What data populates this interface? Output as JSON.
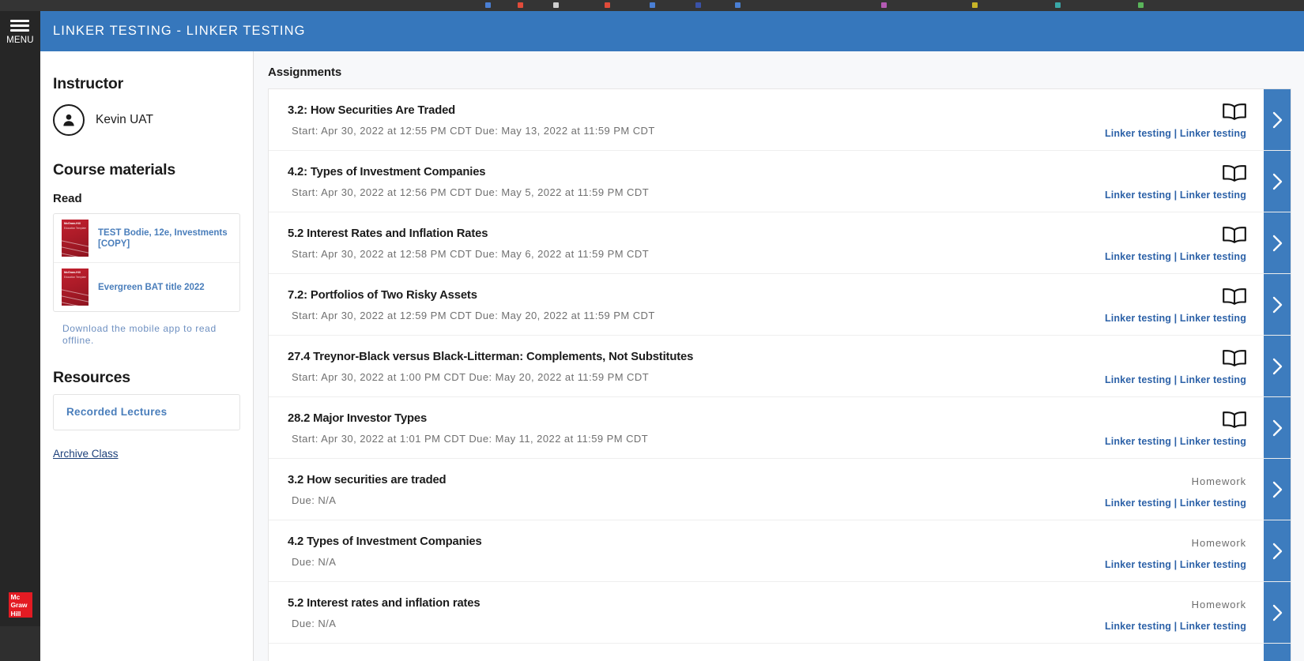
{
  "browser": {
    "strip_color": "#343434"
  },
  "rail": {
    "menu_label": "MENU",
    "menu_icon": "hamburger-icon",
    "logo_line1": "Mc",
    "logo_line2": "Graw",
    "logo_line3": "Hill",
    "logo_color": "#E31B23"
  },
  "header": {
    "title": "LINKER TESTING - LINKER TESTING",
    "background": "#3677BC"
  },
  "sidebar": {
    "instructor_heading": "Instructor",
    "instructor_name": "Kevin UAT",
    "avatar_icon": "user-avatar-icon",
    "course_materials_heading": "Course materials",
    "read_heading": "Read",
    "books": [
      {
        "title": "TEST Bodie, 12e, Investments [COPY]",
        "cover_brand": "McGraw-Hill",
        "cover_sub": "Education Template"
      },
      {
        "title": "Evergreen BAT title 2022",
        "cover_brand": "McGraw-Hill",
        "cover_sub": "Education Template"
      }
    ],
    "mobile_note": "Download the mobile app to read offline.",
    "resources_heading": "Resources",
    "resource_items": [
      "Recorded Lectures"
    ],
    "archive_link": "Archive Class",
    "link_color": "#4A7EBB"
  },
  "main": {
    "title": "Assignments",
    "chevron_icon": "chevron-right-icon",
    "chevron_bg": "#3D7CBE",
    "book_icon": "open-book-icon",
    "assignments": [
      {
        "title": "3.2: How Securities Are Traded",
        "dates": "Start: Apr 30, 2022 at 12:55 PM CDT  Due: May 13, 2022 at 11:59 PM CDT",
        "type_icon": "open-book-icon",
        "type_label": "",
        "links": "Linker testing | Linker testing"
      },
      {
        "title": "4.2: Types of Investment Companies",
        "dates": "Start: Apr 30, 2022 at 12:56 PM CDT  Due: May 5, 2022 at 11:59 PM CDT",
        "type_icon": "open-book-icon",
        "type_label": "",
        "links": "Linker testing | Linker testing"
      },
      {
        "title": "5.2 Interest Rates and Inflation Rates",
        "dates": "Start: Apr 30, 2022 at 12:58 PM CDT  Due: May 6, 2022 at 11:59 PM CDT",
        "type_icon": "open-book-icon",
        "type_label": "",
        "links": "Linker testing | Linker testing"
      },
      {
        "title": "7.2: Portfolios of Two Risky Assets",
        "dates": "Start: Apr 30, 2022 at 12:59 PM CDT  Due: May 20, 2022 at 11:59 PM CDT",
        "type_icon": "open-book-icon",
        "type_label": "",
        "links": "Linker testing | Linker testing"
      },
      {
        "title": "27.4 Treynor-Black versus Black-Litterman: Complements, Not Substitutes",
        "dates": "Start: Apr 30, 2022 at 1:00 PM CDT  Due: May 20, 2022 at 11:59 PM CDT",
        "type_icon": "open-book-icon",
        "type_label": "",
        "links": "Linker testing | Linker testing"
      },
      {
        "title": "28.2 Major Investor Types",
        "dates": "Start: Apr 30, 2022 at 1:01 PM CDT  Due: May 11, 2022 at 11:59 PM CDT",
        "type_icon": "open-book-icon",
        "type_label": "",
        "links": "Linker testing | Linker testing"
      },
      {
        "title": "3.2 How securities are traded",
        "dates": "Due: N/A",
        "type_icon": "",
        "type_label": "Homework",
        "links": "Linker testing | Linker testing"
      },
      {
        "title": "4.2 Types of Investment Companies",
        "dates": "Due: N/A",
        "type_icon": "",
        "type_label": "Homework",
        "links": "Linker testing | Linker testing"
      },
      {
        "title": "5.2 Interest rates and inflation rates",
        "dates": "Due: N/A",
        "type_icon": "",
        "type_label": "Homework",
        "links": "Linker testing | Linker testing"
      }
    ]
  }
}
